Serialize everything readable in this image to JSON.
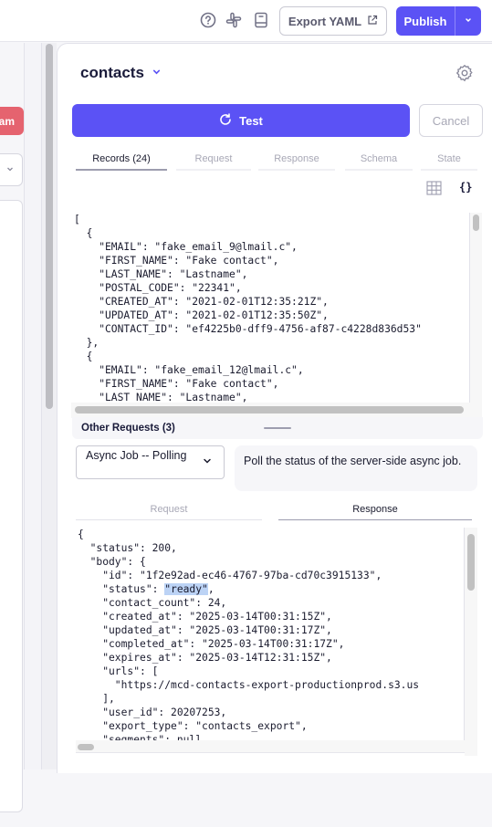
{
  "topbar": {
    "icons": [
      "help-circle-icon",
      "slack-icon",
      "docs-book-icon"
    ],
    "export_label": "Export YAML",
    "publish_label": "Publish",
    "colors": {
      "primary": "#5b52f5",
      "danger": "#e5636f"
    }
  },
  "left_panel": {
    "stream_button_label": "am"
  },
  "stream": {
    "name": "contacts",
    "test_label": "Test",
    "cancel_label": "Cancel",
    "tabs": [
      {
        "label": "Records (24)",
        "active": true
      },
      {
        "label": "Request",
        "active": false
      },
      {
        "label": "Response",
        "active": false
      },
      {
        "label": "Schema",
        "active": false
      },
      {
        "label": "State",
        "active": false
      }
    ],
    "view_json_label": "{}",
    "records_json": "[\n  {\n    \"EMAIL\": \"fake_email_9@lmail.c\",\n    \"FIRST_NAME\": \"Fake contact\",\n    \"LAST_NAME\": \"Lastname\",\n    \"POSTAL_CODE\": \"22341\",\n    \"CREATED_AT\": \"2021-02-01T12:35:21Z\",\n    \"UPDATED_AT\": \"2021-02-01T12:35:50Z\",\n    \"CONTACT_ID\": \"ef4225b0-dff9-4756-af87-c4228d836d53\"\n  },\n  {\n    \"EMAIL\": \"fake_email_12@lmail.c\",\n    \"FIRST_NAME\": \"Fake contact\",\n    \"LAST_NAME\": \"Lastname\","
  },
  "other_requests": {
    "title": "Other Requests (3)",
    "selected": "Async Job -- Polling",
    "description": "Poll the status of the server-side async job.",
    "subtabs": [
      {
        "label": "Request",
        "active": false
      },
      {
        "label": "Response",
        "active": true
      }
    ],
    "response_before": "{\n  \"status\": 200,\n  \"body\": {\n    \"id\": \"1f2e92ad-ec46-4767-97ba-cd70c3915133\",\n    \"status\": ",
    "response_highlight": "\"ready\"",
    "response_after": ",\n    \"contact_count\": 24,\n    \"created_at\": \"2025-03-14T00:31:15Z\",\n    \"updated_at\": \"2025-03-14T00:31:17Z\",\n    \"completed_at\": \"2025-03-14T00:31:17Z\",\n    \"expires_at\": \"2025-03-14T12:31:15Z\",\n    \"urls\": [\n      \"https://mcd-contacts-export-productionprod.s3.us\n    ],\n    \"user_id\": 20207253,\n    \"export_type\": \"contacts_export\",\n    \"segments\": null"
  }
}
